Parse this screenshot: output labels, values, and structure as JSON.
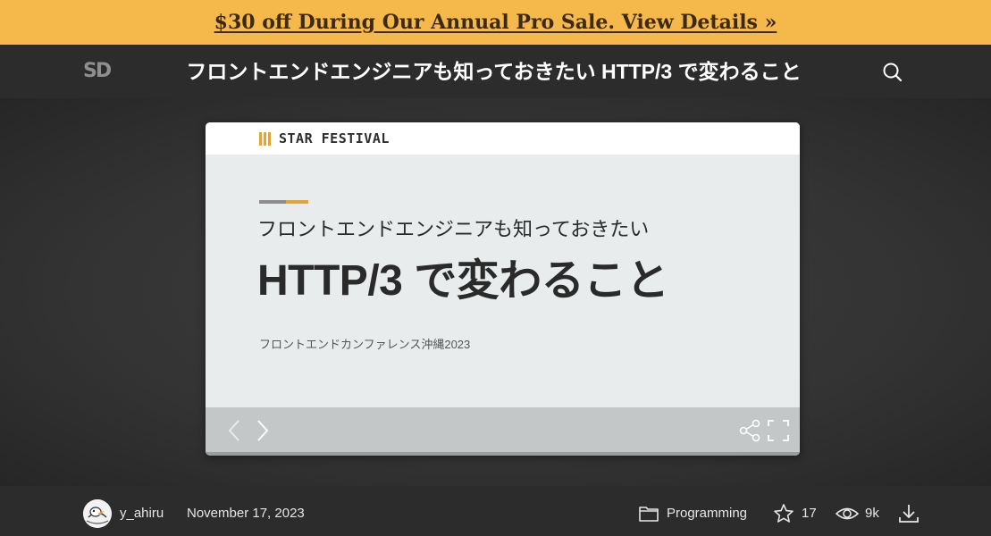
{
  "promo": {
    "text": "$30 off During Our Annual Pro Sale. View Details »",
    "color": "#f5b94b"
  },
  "header": {
    "logo_icon": "speakerdeck-logo-icon",
    "title": "フロントエンドエンジニアも知っておきたい HTTP/3 で変わること",
    "search_icon": "search-icon"
  },
  "slide": {
    "brand": "STAR FESTIVAL",
    "subtitle": "フロントエンドエンジニアも知っておきたい",
    "heading": "HTTP/3 で変わること",
    "event": "フロントエンドカンファレンス沖縄2023",
    "accent_colors": [
      "#8c8c8c",
      "#e2a33a"
    ],
    "controls": {
      "prev_icon": "chevron-left-icon",
      "next_icon": "chevron-right-icon",
      "share_icon": "share-icon",
      "fullscreen_icon": "fullscreen-icon"
    }
  },
  "meta": {
    "username": "y_ahiru",
    "date": "November 17, 2023",
    "category": "Programming",
    "stars": "17",
    "views": "9k",
    "category_icon": "folder-icon",
    "star_icon": "star-icon",
    "views_icon": "eye-icon",
    "download_icon": "download-icon"
  }
}
